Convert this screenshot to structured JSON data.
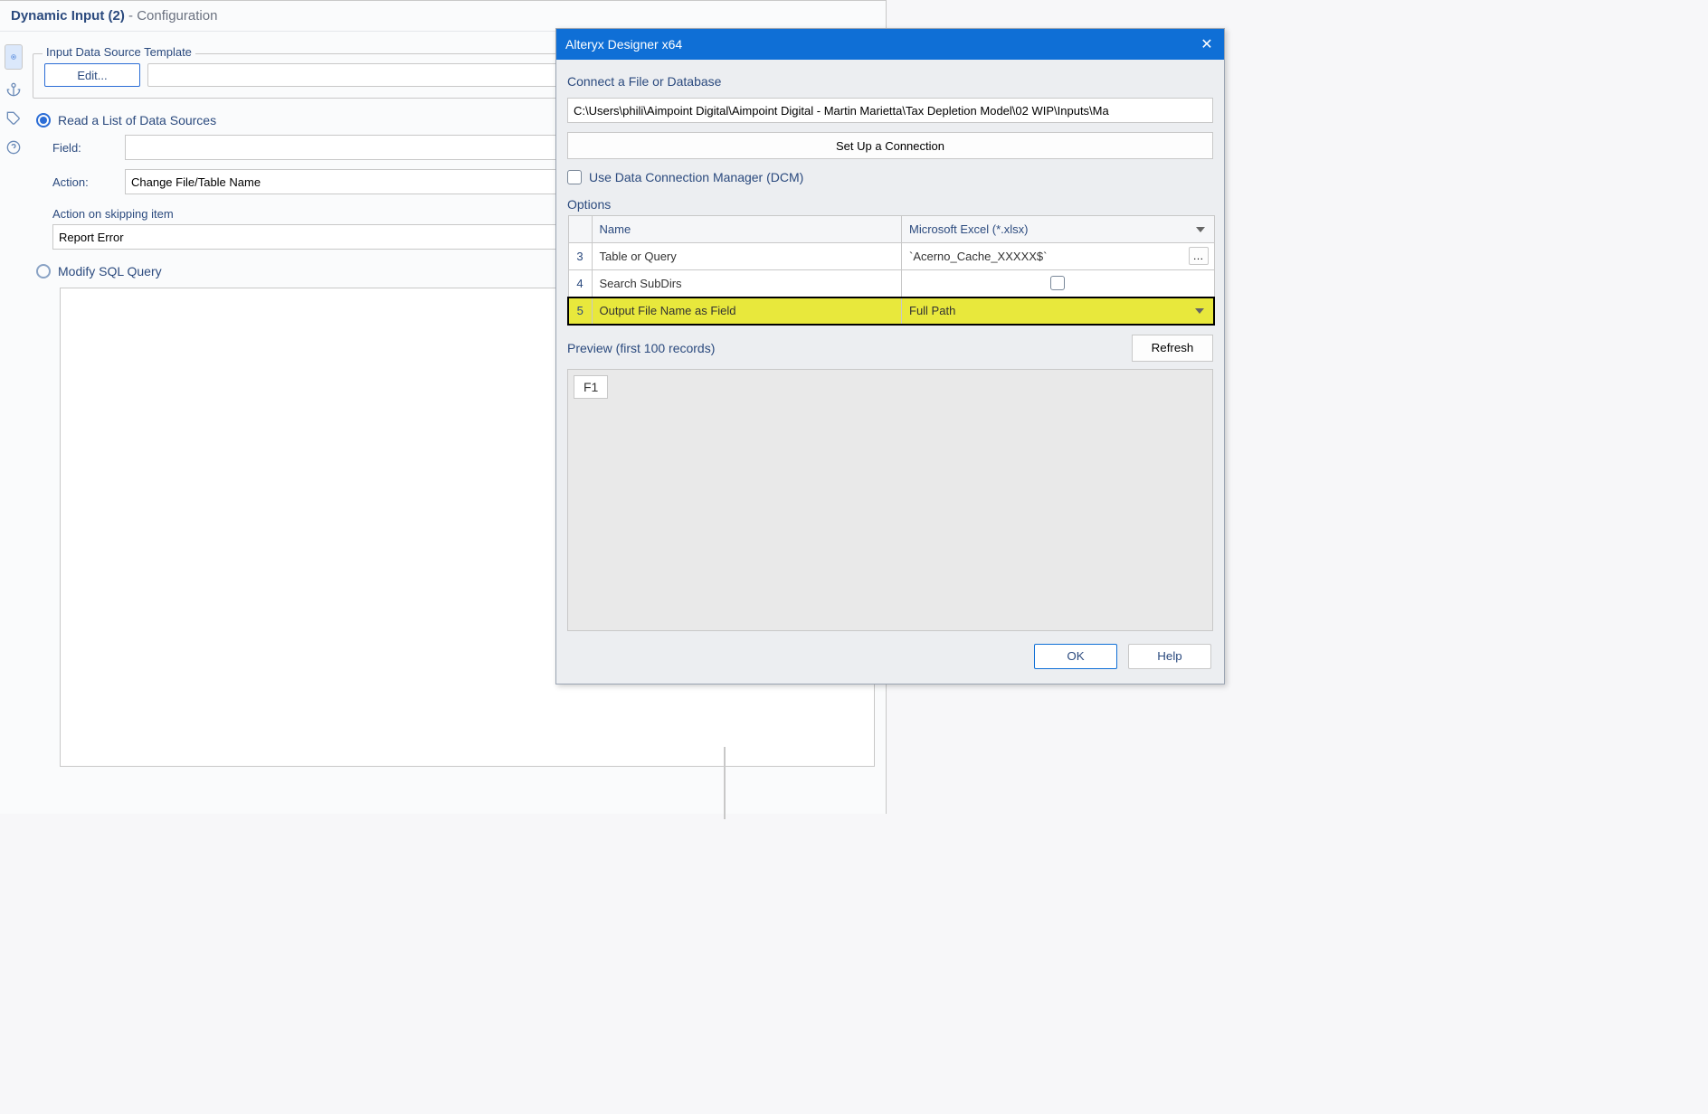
{
  "config": {
    "title": "Dynamic Input (2)",
    "subtitle": " - Configuration",
    "template_group": "Input Data Source Template",
    "edit_label": "Edit...",
    "read_list_label": "Read a List of Data Sources",
    "field_label": "Field:",
    "field_value": "",
    "action_label": "Action:",
    "action_value": "Change File/Table Name",
    "skip_label": "Action on skipping item",
    "skip_value": "Report Error",
    "modify_sql_label": "Modify SQL Query"
  },
  "dialog": {
    "title": "Alteryx Designer x64",
    "connect_h": "Connect a File or Database",
    "path": "C:\\Users\\phili\\Aimpoint Digital\\Aimpoint Digital - Martin Marietta\\Tax Depletion Model\\02 WIP\\Inputs\\Ma",
    "setup_btn": "Set Up a Connection",
    "dcm_label": "Use Data Connection Manager (DCM)",
    "options_h": "Options",
    "table": {
      "headers": [
        "",
        "Name",
        ""
      ],
      "name_header_value": "Microsoft Excel (*.xlsx)",
      "rows": [
        {
          "num": "3",
          "name": "Table or Query",
          "value": "`Acerno_Cache_XXXXX$`",
          "dots": true
        },
        {
          "num": "4",
          "name": "Search SubDirs",
          "value": "",
          "chk": true
        },
        {
          "num": "5",
          "name": "Output File Name as Field",
          "value": "Full Path",
          "drop": true,
          "hl": true
        }
      ]
    },
    "preview_label": "Preview (first 100 records)",
    "refresh_label": "Refresh",
    "preview_col": "F1",
    "ok_label": "OK",
    "help_label": "Help"
  }
}
